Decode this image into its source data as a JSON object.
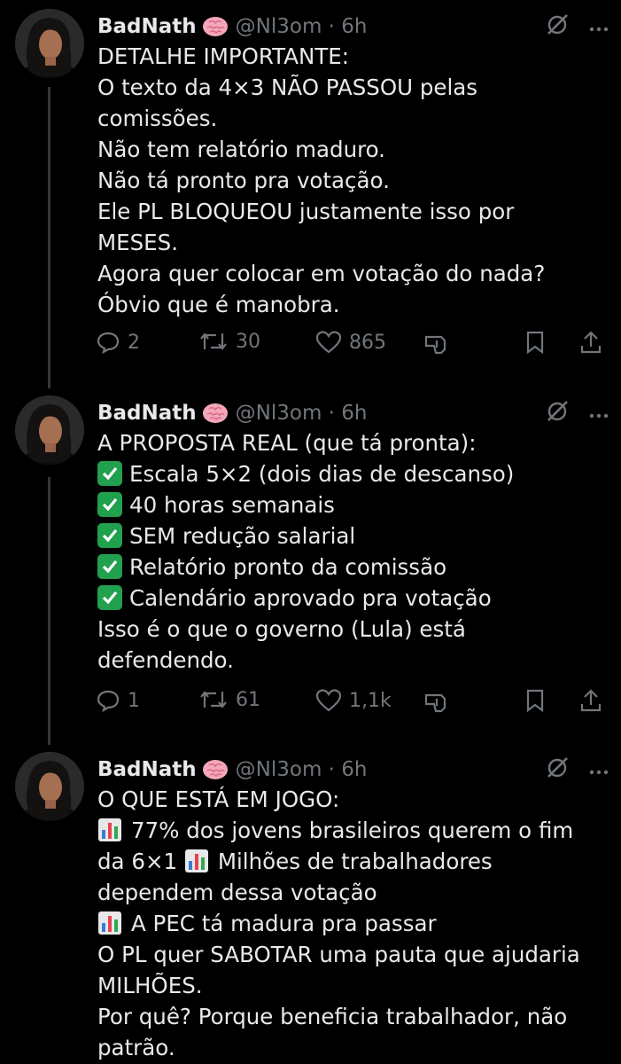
{
  "colors": {
    "background": "#000000",
    "text": "#e7e9ea",
    "muted": "#71767b",
    "check": "#21a04d"
  },
  "tweets": [
    {
      "name": "BadNath",
      "handle": "@Nl3om · 6h",
      "lines": [
        "DETALHE IMPORTANTE:",
        "O texto da 4×3 NÃO PASSOU pelas",
        "comissões.",
        "Não tem relatório maduro.",
        "Não tá pronto pra votação.",
        "Ele PL BLOQUEOU justamente isso por",
        "MESES.",
        "Agora quer colocar em votação do nada?",
        "Óbvio que é manobra."
      ],
      "replies": "2",
      "reposts": "30",
      "likes": "865"
    },
    {
      "name": "BadNath",
      "handle": "@Nl3om · 6h",
      "intro": "A PROPOSTA REAL (que tá pronta):",
      "checks": [
        "Escala 5×2 (dois dias de descanso)",
        "40 horas semanais",
        "SEM redução salarial",
        "Relatório pronto da comissão",
        "Calendário aprovado pra votação"
      ],
      "outro": [
        "Isso é o que o governo (Lula) está",
        "defendendo."
      ],
      "replies": "1",
      "reposts": "61",
      "likes": "1,1k"
    },
    {
      "name": "BadNath",
      "handle": "@Nl3om · 6h",
      "l1": "O QUE ESTÁ EM JOGO:",
      "l2": "77% dos jovens brasileiros querem o fim",
      "l3a": "da 6×1",
      "l3b": "Milhões de trabalhadores",
      "l4": "dependem dessa votação",
      "l5": "A PEC tá madura pra passar",
      "l6": "O PL quer SABOTAR uma pauta que ajudaria",
      "l7": "MILHÕES.",
      "l8": "Por quê? Porque beneficia trabalhador, não",
      "l9": "patrão."
    }
  ],
  "icons": {
    "reply": "reply-icon",
    "repost": "repost-icon",
    "like": "heart-icon",
    "stats": "stats-icon",
    "bookmark": "bookmark-icon",
    "share": "share-icon",
    "grok": "grok-icon",
    "more": "more-icon",
    "brain": "brain-emoji",
    "check": "check-mark-emoji",
    "chart": "bar-chart-emoji"
  }
}
